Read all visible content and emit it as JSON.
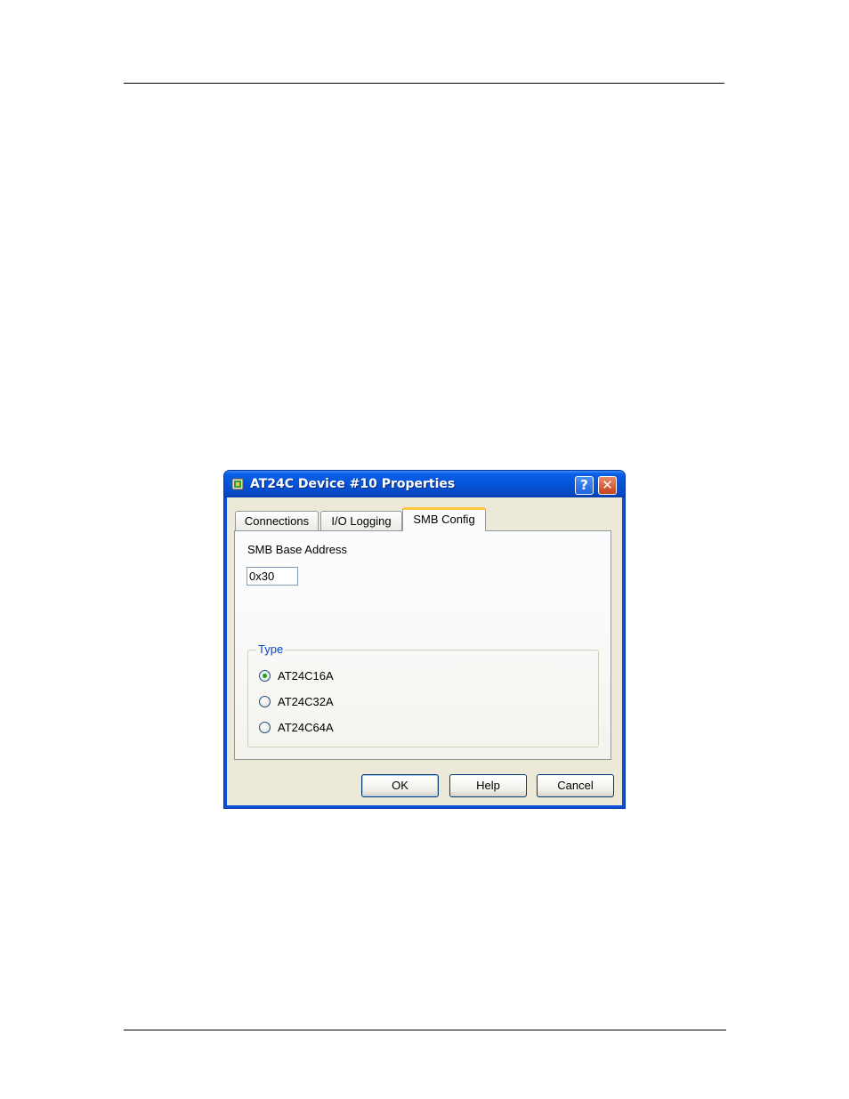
{
  "window": {
    "title": "AT24C Device #10 Properties",
    "help_button_label": "?",
    "close_button_label": "✕"
  },
  "tabs": [
    {
      "label": "Connections",
      "selected": false
    },
    {
      "label": "I/O Logging",
      "selected": false
    },
    {
      "label": "SMB Config",
      "selected": true
    }
  ],
  "smb_config": {
    "base_address_label": "SMB Base Address",
    "base_address_value": "0x30"
  },
  "type_group": {
    "legend": "Type",
    "options": [
      {
        "label": "AT24C16A",
        "checked": true
      },
      {
        "label": "AT24C32A",
        "checked": false
      },
      {
        "label": "AT24C64A",
        "checked": false
      }
    ]
  },
  "buttons": {
    "ok": "OK",
    "help": "Help",
    "cancel": "Cancel"
  },
  "colors": {
    "titlebar": "#0453d8",
    "dialog_face": "#ece9d8",
    "group_legend": "#0046d5",
    "active_tab_accent": "#ffc83c",
    "radio_check": "#21a121",
    "close_button": "#c7421c"
  },
  "icons": {
    "app": "device-icon",
    "help": "question-mark-icon",
    "close": "close-icon"
  }
}
